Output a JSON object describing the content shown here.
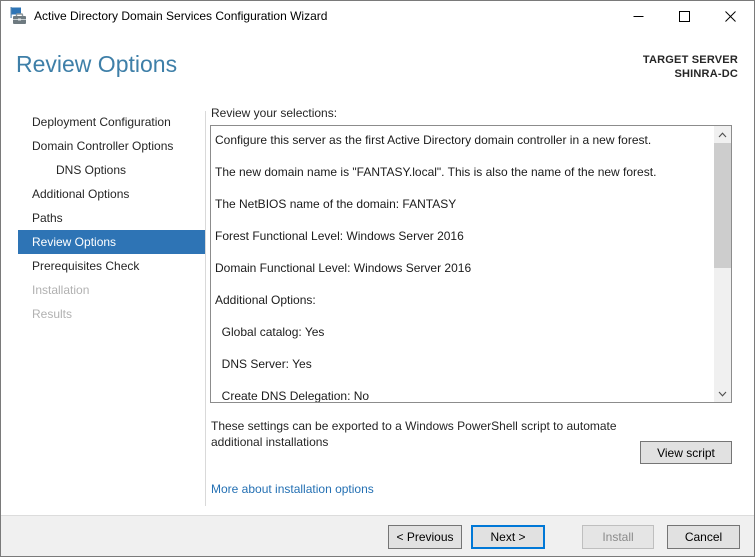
{
  "window": {
    "title": "Active Directory Domain Services Configuration Wizard"
  },
  "header": {
    "title": "Review Options",
    "target_server_label": "TARGET SERVER",
    "target_server_name": "SHINRA-DC"
  },
  "sidebar": {
    "items": [
      {
        "label": "Deployment Configuration",
        "state": "normal",
        "indent": 0
      },
      {
        "label": "Domain Controller Options",
        "state": "normal",
        "indent": 0
      },
      {
        "label": "DNS Options",
        "state": "normal",
        "indent": 1
      },
      {
        "label": "Additional Options",
        "state": "normal",
        "indent": 0
      },
      {
        "label": "Paths",
        "state": "normal",
        "indent": 0
      },
      {
        "label": "Review Options",
        "state": "selected",
        "indent": 0
      },
      {
        "label": "Prerequisites Check",
        "state": "normal",
        "indent": 0
      },
      {
        "label": "Installation",
        "state": "disabled",
        "indent": 0
      },
      {
        "label": "Results",
        "state": "disabled",
        "indent": 0
      }
    ]
  },
  "main": {
    "review_label": "Review your selections:",
    "review_lines": [
      "Configure this server as the first Active Directory domain controller in a new forest.",
      "The new domain name is \"FANTASY.local\". This is also the name of the new forest.",
      "The NetBIOS name of the domain: FANTASY",
      "Forest Functional Level: Windows Server 2016",
      "Domain Functional Level: Windows Server 2016",
      "Additional Options:",
      "  Global catalog: Yes",
      "  DNS Server: Yes",
      "  Create DNS Delegation: No"
    ],
    "export_note": "These settings can be exported to a Windows PowerShell script to automate additional installations",
    "view_script_button": "View script",
    "more_link": "More about installation options"
  },
  "footer": {
    "previous": "< Previous",
    "next": "Next >",
    "install": "Install",
    "cancel": "Cancel"
  },
  "icons": {
    "app": "adds-wizard-icon",
    "minimize": "minimize-icon",
    "maximize": "maximize-icon",
    "close": "close-icon",
    "scroll_up": "chevron-up-icon",
    "scroll_down": "chevron-down-icon"
  },
  "colors": {
    "nav_selected_bg": "#2e74b5",
    "heading_blue": "#3e7fa8",
    "link_blue": "#2470b3",
    "next_button_border": "#0078d7",
    "footer_bg": "#f0f0f0",
    "scroll_track": "#f0f0f0",
    "scroll_thumb": "#cdcdcd",
    "disabled_text": "#b1b1b1"
  }
}
